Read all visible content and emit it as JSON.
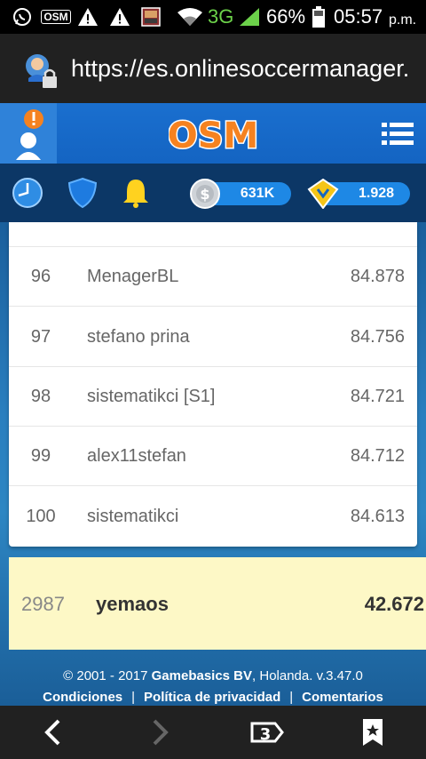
{
  "status_bar": {
    "network": "3G",
    "battery": "66%",
    "time": "05:57",
    "ampm": "p.m.",
    "osm_label": "OSM"
  },
  "browser": {
    "url": "https://es.onlinesoccermanager.",
    "tab_count": "3"
  },
  "app": {
    "logo": "OSM",
    "coins": "631K",
    "boss_coins": "1.928",
    "alert_badge": "!"
  },
  "ranking": {
    "rows": [
      {
        "rank": "96",
        "name": "MenagerBL",
        "points": "84.878"
      },
      {
        "rank": "97",
        "name": "stefano prina",
        "points": "84.756"
      },
      {
        "rank": "98",
        "name": "sistematikci [S1]",
        "points": "84.721"
      },
      {
        "rank": "99",
        "name": "alex11stefan",
        "points": "84.712"
      },
      {
        "rank": "100",
        "name": "sistematikci",
        "points": "84.613"
      }
    ],
    "own": {
      "rank": "2987",
      "name": "yemaos",
      "points": "42.672"
    }
  },
  "footer": {
    "copyright_prefix": "© 2001 - 2017 ",
    "company": "Gamebasics BV",
    "copyright_suffix": ", Holanda. v.3.47.0",
    "links": [
      "Condiciones",
      "Política de privacidad",
      "Comentarios"
    ]
  },
  "colors": {
    "header_blue": "#1a6fcf",
    "logo_orange": "#f58220",
    "highlight_row": "#fdf8c6",
    "pill_blue": "#1e88e5"
  }
}
